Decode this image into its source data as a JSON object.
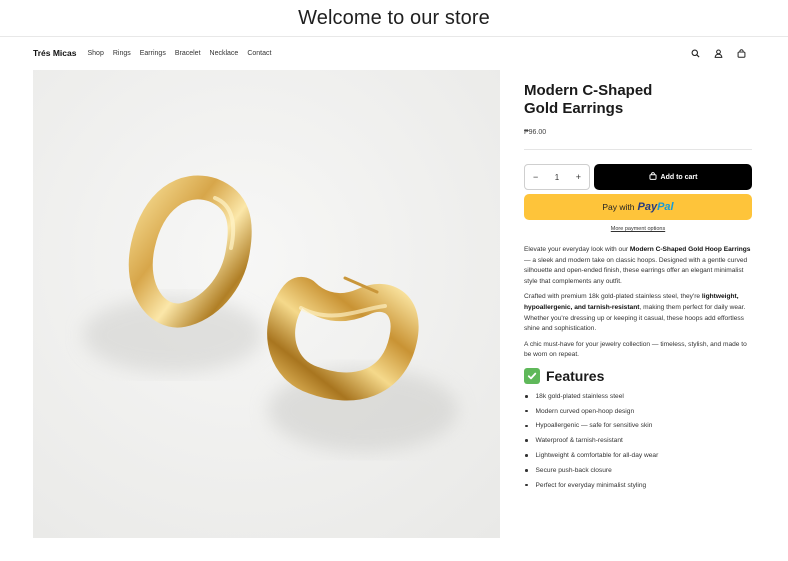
{
  "announcement": "Welcome to our store",
  "brand": "Trés Micas",
  "nav": [
    "Shop",
    "Rings",
    "Earrings",
    "Bracelet",
    "Necklace",
    "Contact"
  ],
  "icons": {
    "search": "search-icon",
    "account": "user-icon",
    "cart": "bag-icon"
  },
  "product": {
    "title_line1": "Modern C-Shaped",
    "title_line2": "Gold Earrings",
    "price": "₱96.00",
    "quantity": "1",
    "qty_minus": "−",
    "qty_plus": "+",
    "add_to_cart": "Add to cart",
    "paypal_prefix": "Pay with",
    "paypal_word1": "Pay",
    "paypal_word2": "Pal",
    "more_payment": "More payment options"
  },
  "description": {
    "p1_a": "Elevate your everyday look with our ",
    "p1_b": "Modern C-Shaped Gold Hoop Earrings",
    "p1_c": " — a sleek and modern take on classic hoops. Designed with a gentle curved silhouette and open-ended finish, these earrings offer an elegant minimalist style that complements any outfit.",
    "p2_a": "Crafted with premium 18k gold-plated stainless steel, they're ",
    "p2_b": "lightweight, hypoallergenic, and tarnish-resistant",
    "p2_c": ", making them perfect for daily wear. Whether you're dressing up or keeping it casual, these hoops add effortless shine and sophistication.",
    "p3": "A chic must-have for your jewelry collection — timeless, stylish, and made to be worn on repeat."
  },
  "features_title": "Features",
  "features": [
    "18k gold-plated stainless steel",
    "Modern curved open-hoop design",
    "Hypoallergenic — safe for sensitive skin",
    "Waterproof & tarnish-resistant",
    "Lightweight & comfortable for all-day wear",
    "Secure push-back closure",
    "Perfect for everyday minimalist styling"
  ],
  "colors": {
    "accent_black": "#000000",
    "paypal_yellow": "#fec43a",
    "check_green": "#5fb85a",
    "gold": "#d4a648"
  }
}
